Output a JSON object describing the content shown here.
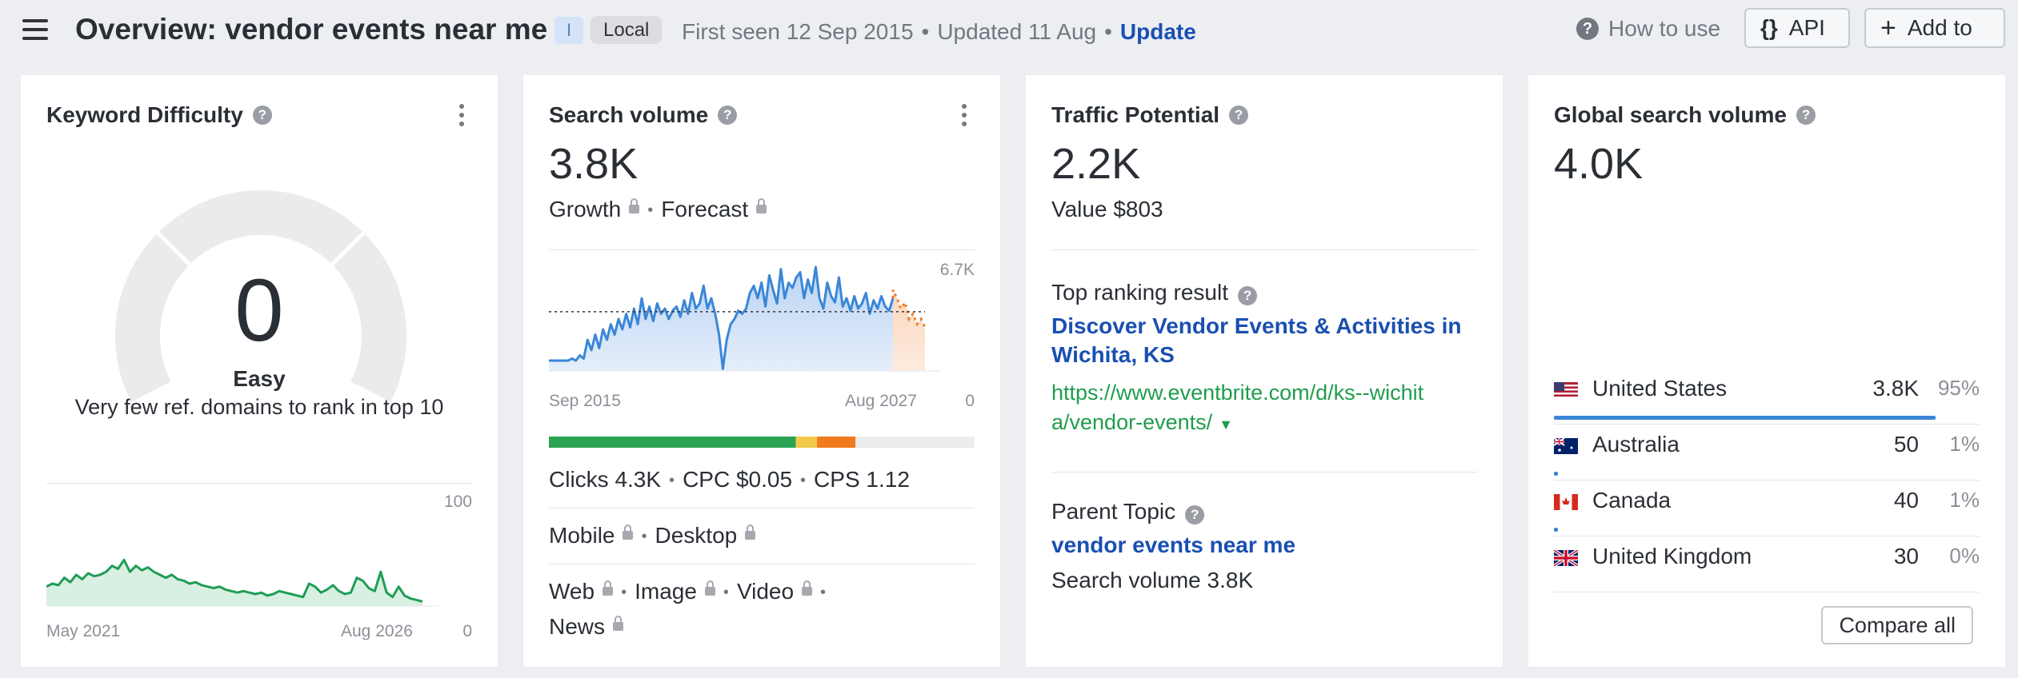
{
  "header": {
    "title": "Overview: vendor events near me",
    "badge_i": "I",
    "badge_local": "Local",
    "first_seen": "First seen 12 Sep 2015",
    "updated": "Updated 11 Aug",
    "update_link": "Update",
    "how_to_use": "How to use",
    "api_label": "API",
    "add_to_label": "Add to"
  },
  "kd": {
    "title": "Keyword Difficulty",
    "value": "0",
    "label": "Easy",
    "description": "Very few ref. domains to rank in top 10",
    "chart_max": "100",
    "chart_min": "0",
    "x_start": "May 2021",
    "x_end": "Aug 2026",
    "trend": [
      12,
      14,
      13,
      18,
      15,
      20,
      17,
      21,
      19,
      20,
      22,
      26,
      24,
      30,
      22,
      26,
      23,
      25,
      22,
      20,
      18,
      20,
      17,
      16,
      14,
      15,
      13,
      12,
      11,
      12,
      10,
      9,
      8,
      9,
      8,
      7,
      8,
      6,
      7,
      9,
      8,
      7,
      6,
      5,
      14,
      12,
      8,
      10,
      13,
      9,
      7,
      8,
      18,
      16,
      11,
      9,
      22,
      8,
      5,
      12,
      6,
      4,
      3,
      2
    ]
  },
  "volume": {
    "title": "Search volume",
    "value": "3.8K",
    "growth": "Growth",
    "forecast": "Forecast",
    "chart_max": "6.7K",
    "chart_min": "0",
    "x_start": "Sep 2015",
    "x_end": "Aug 2027",
    "history": [
      0.1,
      0.1,
      0.1,
      0.1,
      0.1,
      0.1,
      0.12,
      0.1,
      0.15,
      0.12,
      0.3,
      0.2,
      0.35,
      0.22,
      0.4,
      0.3,
      0.45,
      0.35,
      0.5,
      0.4,
      0.55,
      0.42,
      0.6,
      0.45,
      0.7,
      0.5,
      0.62,
      0.48,
      0.65,
      0.55,
      0.6,
      0.5,
      0.58,
      0.62,
      0.52,
      0.68,
      0.55,
      0.75,
      0.6,
      0.65,
      0.82,
      0.6,
      0.7,
      0.55,
      0.35,
      0.02,
      0.3,
      0.45,
      0.5,
      0.58,
      0.55,
      0.6,
      0.75,
      0.82,
      0.7,
      0.85,
      0.62,
      0.92,
      0.78,
      0.65,
      0.98,
      0.7,
      0.85,
      0.8,
      0.9,
      0.95,
      0.7,
      0.88,
      0.75,
      1.0,
      0.7,
      0.6,
      0.85,
      0.72,
      0.66,
      0.9,
      0.62,
      0.7,
      0.58,
      0.72,
      0.6,
      0.65,
      0.75,
      0.55,
      0.68,
      0.6,
      0.72,
      0.62,
      0.58,
      0.7
    ],
    "forecast_values": [
      0.78,
      0.7,
      0.6,
      0.66,
      0.5,
      0.55,
      0.45,
      0.5,
      0.42
    ],
    "average": 0.57,
    "clicks": "Clicks 4.3K",
    "cpc": "CPC $0.05",
    "cps": "CPS 1.12",
    "mobile": "Mobile",
    "desktop": "Desktop",
    "web": "Web",
    "image": "Image",
    "video": "Video",
    "news": "News",
    "click_split": {
      "green": 0.58,
      "yellow": 0.05,
      "orange": 0.09
    }
  },
  "traffic": {
    "title": "Traffic Potential",
    "value": "2.2K",
    "value_usd": "Value $803",
    "top_result_label": "Top ranking result",
    "top_result_title_1": "Discover Vendor Events & Activities in",
    "top_result_title_2": "Wichita, KS",
    "top_result_url_1": "https://www.eventbrite.com/d/ks--wichit",
    "top_result_url_2": "a/vendor-events/",
    "parent_topic_label": "Parent Topic",
    "parent_topic": "vendor events near me",
    "parent_volume": "Search volume 3.8K"
  },
  "global": {
    "title": "Global search volume",
    "value": "4.0K",
    "countries": [
      {
        "name": "United States",
        "value": "3.8K",
        "pct": "95%",
        "share": 0.95,
        "flag": "us"
      },
      {
        "name": "Australia",
        "value": "50",
        "pct": "1%",
        "share": 0.01,
        "flag": "au"
      },
      {
        "name": "Canada",
        "value": "40",
        "pct": "1%",
        "share": 0.01,
        "flag": "ca"
      },
      {
        "name": "United Kingdom",
        "value": "30",
        "pct": "0%",
        "share": 0.005,
        "flag": "uk"
      }
    ],
    "compare_all": "Compare all"
  }
}
